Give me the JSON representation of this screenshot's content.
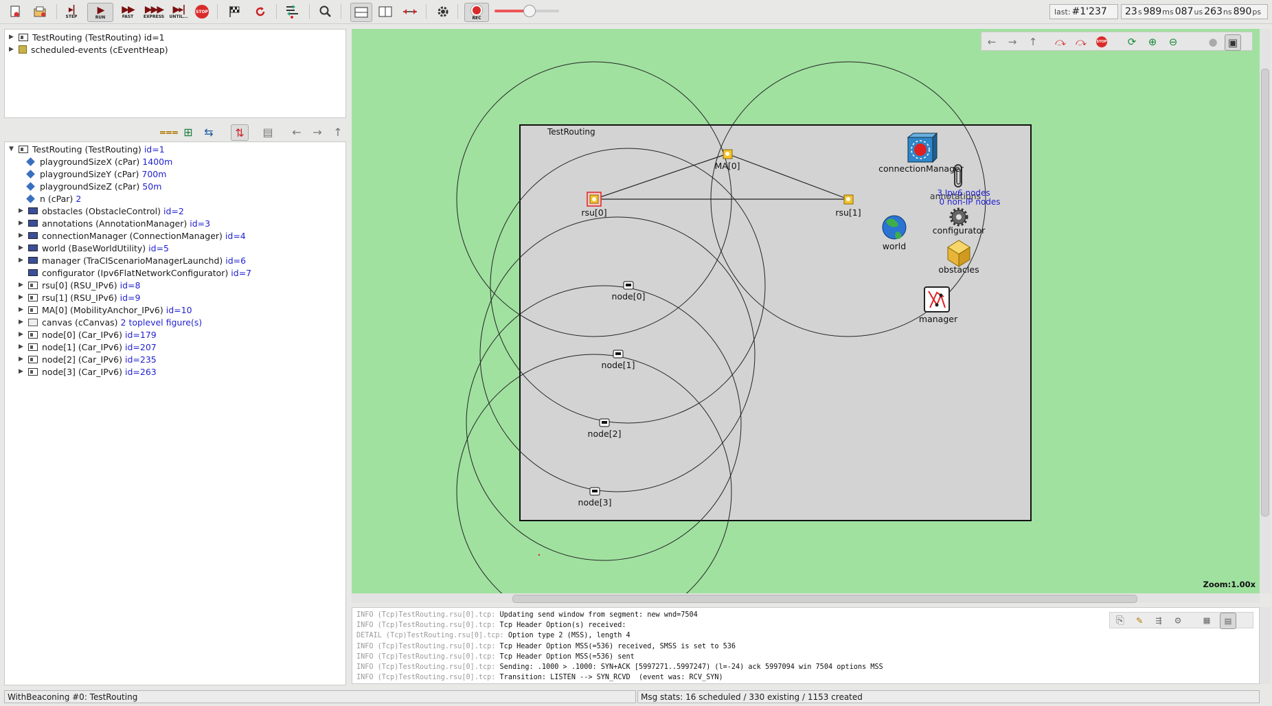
{
  "toolbar": {
    "buttons": {
      "step": "STEP",
      "run": "RUN",
      "fast": "FAST",
      "express": "EXPRESS",
      "until": "UNTIL...",
      "stop": "STOP",
      "rec": "REC",
      "rec2": "REC"
    },
    "last_event_label": "last:",
    "last_event_value": "#1'237",
    "sim_time": {
      "s": "23",
      "ms": "989",
      "us": "087",
      "ns": "263",
      "ps": "890"
    },
    "sim_time_units": {
      "s": "s",
      "ms": "ms",
      "us": "us",
      "ns": "ns",
      "ps": "ps"
    },
    "speed_level": 0.53
  },
  "object_tree": [
    {
      "label": "TestRouting (TestRouting) id=1",
      "icon": "module-icon"
    },
    {
      "label": "scheduled-events (cEventHeap)",
      "icon": "event-heap-icon"
    }
  ],
  "inspector": {
    "root": {
      "label": "TestRouting (TestRouting)",
      "id": "id=1"
    },
    "params": [
      {
        "name": "playgroundSizeX (cPar)",
        "value": "1400m"
      },
      {
        "name": "playgroundSizeY (cPar)",
        "value": "700m"
      },
      {
        "name": "playgroundSizeZ (cPar)",
        "value": "50m"
      },
      {
        "name": "n (cPar)",
        "value": "2"
      }
    ],
    "submodules": [
      {
        "name": "obstacles (ObstacleControl)",
        "id": "id=2",
        "icon": "simple",
        "expand": true
      },
      {
        "name": "annotations (AnnotationManager)",
        "id": "id=3",
        "icon": "simple",
        "expand": true
      },
      {
        "name": "connectionManager (ConnectionManager)",
        "id": "id=4",
        "icon": "simple",
        "expand": true
      },
      {
        "name": "world (BaseWorldUtility)",
        "id": "id=5",
        "icon": "simple",
        "expand": true
      },
      {
        "name": "manager (TraCIScenarioManagerLaunchd)",
        "id": "id=6",
        "icon": "simple",
        "expand": true
      },
      {
        "name": "configurator (Ipv6FlatNetworkConfigurator)",
        "id": "id=7",
        "icon": "simple",
        "expand": false
      },
      {
        "name": "rsu[0] (RSU_IPv6)",
        "id": "id=8",
        "icon": "compound",
        "expand": true
      },
      {
        "name": "rsu[1] (RSU_IPv6)",
        "id": "id=9",
        "icon": "compound",
        "expand": true
      },
      {
        "name": "MA[0] (MobilityAnchor_IPv6)",
        "id": "id=10",
        "icon": "compound",
        "expand": true
      },
      {
        "name": "canvas (cCanvas)",
        "id": "2 toplevel figure(s)",
        "icon": "canvas",
        "expand": true
      },
      {
        "name": "node[0] (Car_IPv6)",
        "id": "id=179",
        "icon": "compound",
        "expand": true
      },
      {
        "name": "node[1] (Car_IPv6)",
        "id": "id=207",
        "icon": "compound",
        "expand": true
      },
      {
        "name": "node[2] (Car_IPv6)",
        "id": "id=235",
        "icon": "compound",
        "expand": true
      },
      {
        "name": "node[3] (Car_IPv6)",
        "id": "id=263",
        "icon": "compound",
        "expand": true
      }
    ]
  },
  "network": {
    "title": "TestRouting",
    "nodes": {
      "rsu0": "rsu[0]",
      "rsu1": "rsu[1]",
      "ma0": "MA[0]",
      "node0": "node[0]",
      "node1": "node[1]",
      "node2": "node[2]",
      "node3": "node[3]",
      "connectionManager": "connectionManager",
      "annotations": "annotations",
      "world": "world",
      "configurator": "configurator",
      "obstacles": "obstacles",
      "manager": "manager"
    },
    "configurator_info": [
      "3 Ipv6 nodes",
      "0 non-IP nodes"
    ],
    "zoom": "Zoom:1.00x"
  },
  "log": [
    {
      "prefix": "INFO (Tcp)TestRouting.rsu[0].tcp:",
      "msg": "Updating send window from segment: new wnd=7504"
    },
    {
      "prefix": "INFO (Tcp)TestRouting.rsu[0].tcp:",
      "msg": "Tcp Header Option(s) received:"
    },
    {
      "prefix": "DETAIL (Tcp)TestRouting.rsu[0].tcp:",
      "msg": "Option type 2 (MSS), length 4"
    },
    {
      "prefix": "INFO (Tcp)TestRouting.rsu[0].tcp:",
      "msg": "Tcp Header Option MSS(=536) received, SMSS is set to 536"
    },
    {
      "prefix": "INFO (Tcp)TestRouting.rsu[0].tcp:",
      "msg": "Tcp Header Option MSS(=536) sent"
    },
    {
      "prefix": "INFO (Tcp)TestRouting.rsu[0].tcp:",
      "msg": "Sending: .1000 > .1000: SYN+ACK [5997271..5997247) (l=-24) ack 5997094 win 7504 options MSS"
    },
    {
      "prefix": "INFO (Tcp)TestRouting.rsu[0].tcp:",
      "msg": "Transition: LISTEN --> SYN_RCVD  (event was: RCV_SYN)"
    }
  ],
  "statusbar": {
    "left": "WithBeaconing #0: TestRouting",
    "right": "Msg stats: 16 scheduled / 330 existing / 1153 created"
  },
  "colors": {
    "canvas_bg": "#a0e1a0",
    "network_bg": "#d3d3d3",
    "id_link": "#1f1fd0",
    "rec": "#d92b2b"
  }
}
